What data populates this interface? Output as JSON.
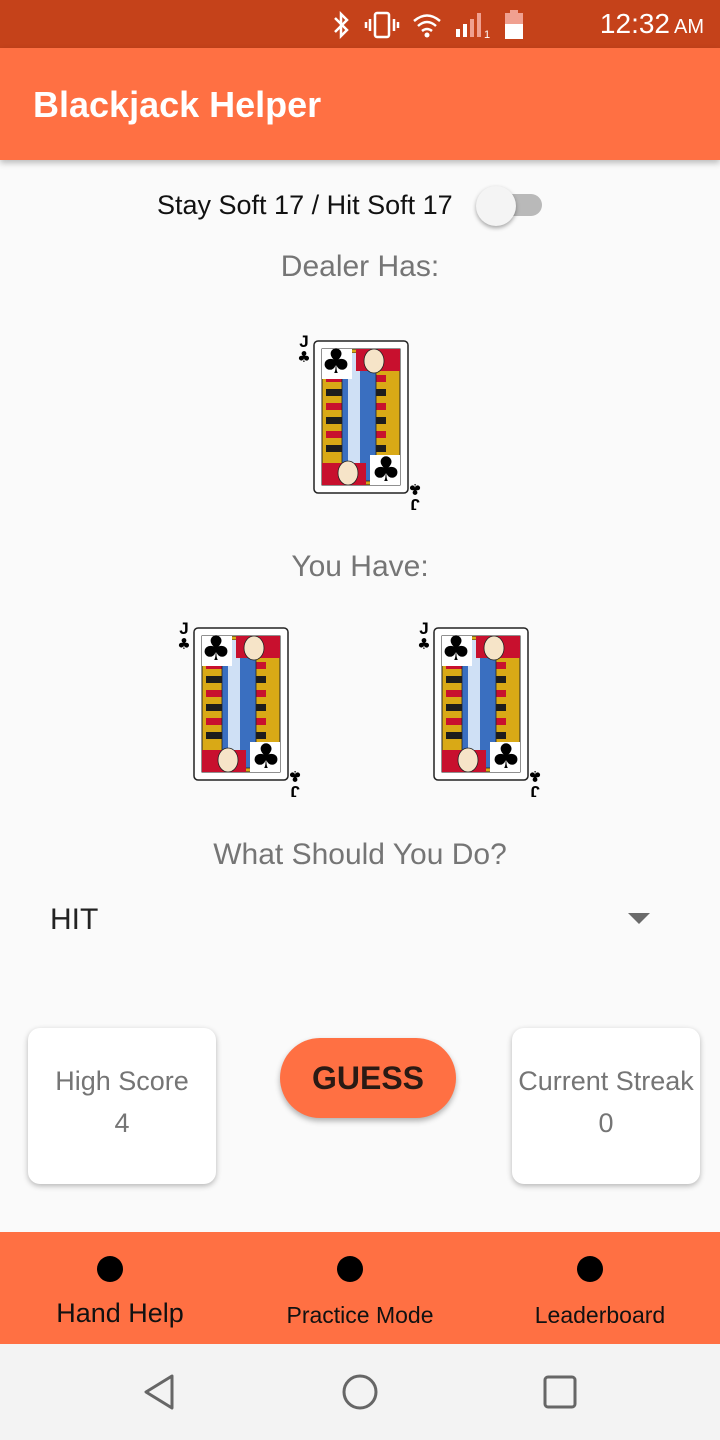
{
  "status_bar": {
    "time": "12:32",
    "ampm": "AM",
    "signal_sim": "1",
    "icons": [
      "bluetooth-icon",
      "vibrate-icon",
      "wifi-icon",
      "cell-signal-icon",
      "battery-icon"
    ]
  },
  "app_bar": {
    "title": "Blackjack Helper"
  },
  "settings": {
    "toggle_label": "Stay Soft 17 / Hit Soft 17",
    "toggle_on": false
  },
  "dealer": {
    "label": "Dealer Has:",
    "cards": [
      {
        "rank": "J",
        "suit": "♣"
      }
    ]
  },
  "player": {
    "label": "You Have:",
    "cards": [
      {
        "rank": "J",
        "suit": "♣"
      },
      {
        "rank": "J",
        "suit": "♣"
      }
    ]
  },
  "action": {
    "prompt": "What Should You Do?",
    "selected": "HIT"
  },
  "scores": {
    "high_score_label": "High Score",
    "high_score_value": "4",
    "streak_label": "Current Streak",
    "streak_value": "0"
  },
  "guess_button": {
    "label": "GUESS"
  },
  "bottom_nav": {
    "items": [
      {
        "label": "Hand Help",
        "active": true
      },
      {
        "label": "Practice Mode",
        "active": false
      },
      {
        "label": "Leaderboard",
        "active": false
      }
    ]
  },
  "colors": {
    "primary": "#ff7043",
    "primary_dark": "#c5421a",
    "text_secondary": "#757575"
  },
  "system_nav": {
    "icons": [
      "back-icon",
      "home-icon",
      "recents-icon"
    ]
  }
}
